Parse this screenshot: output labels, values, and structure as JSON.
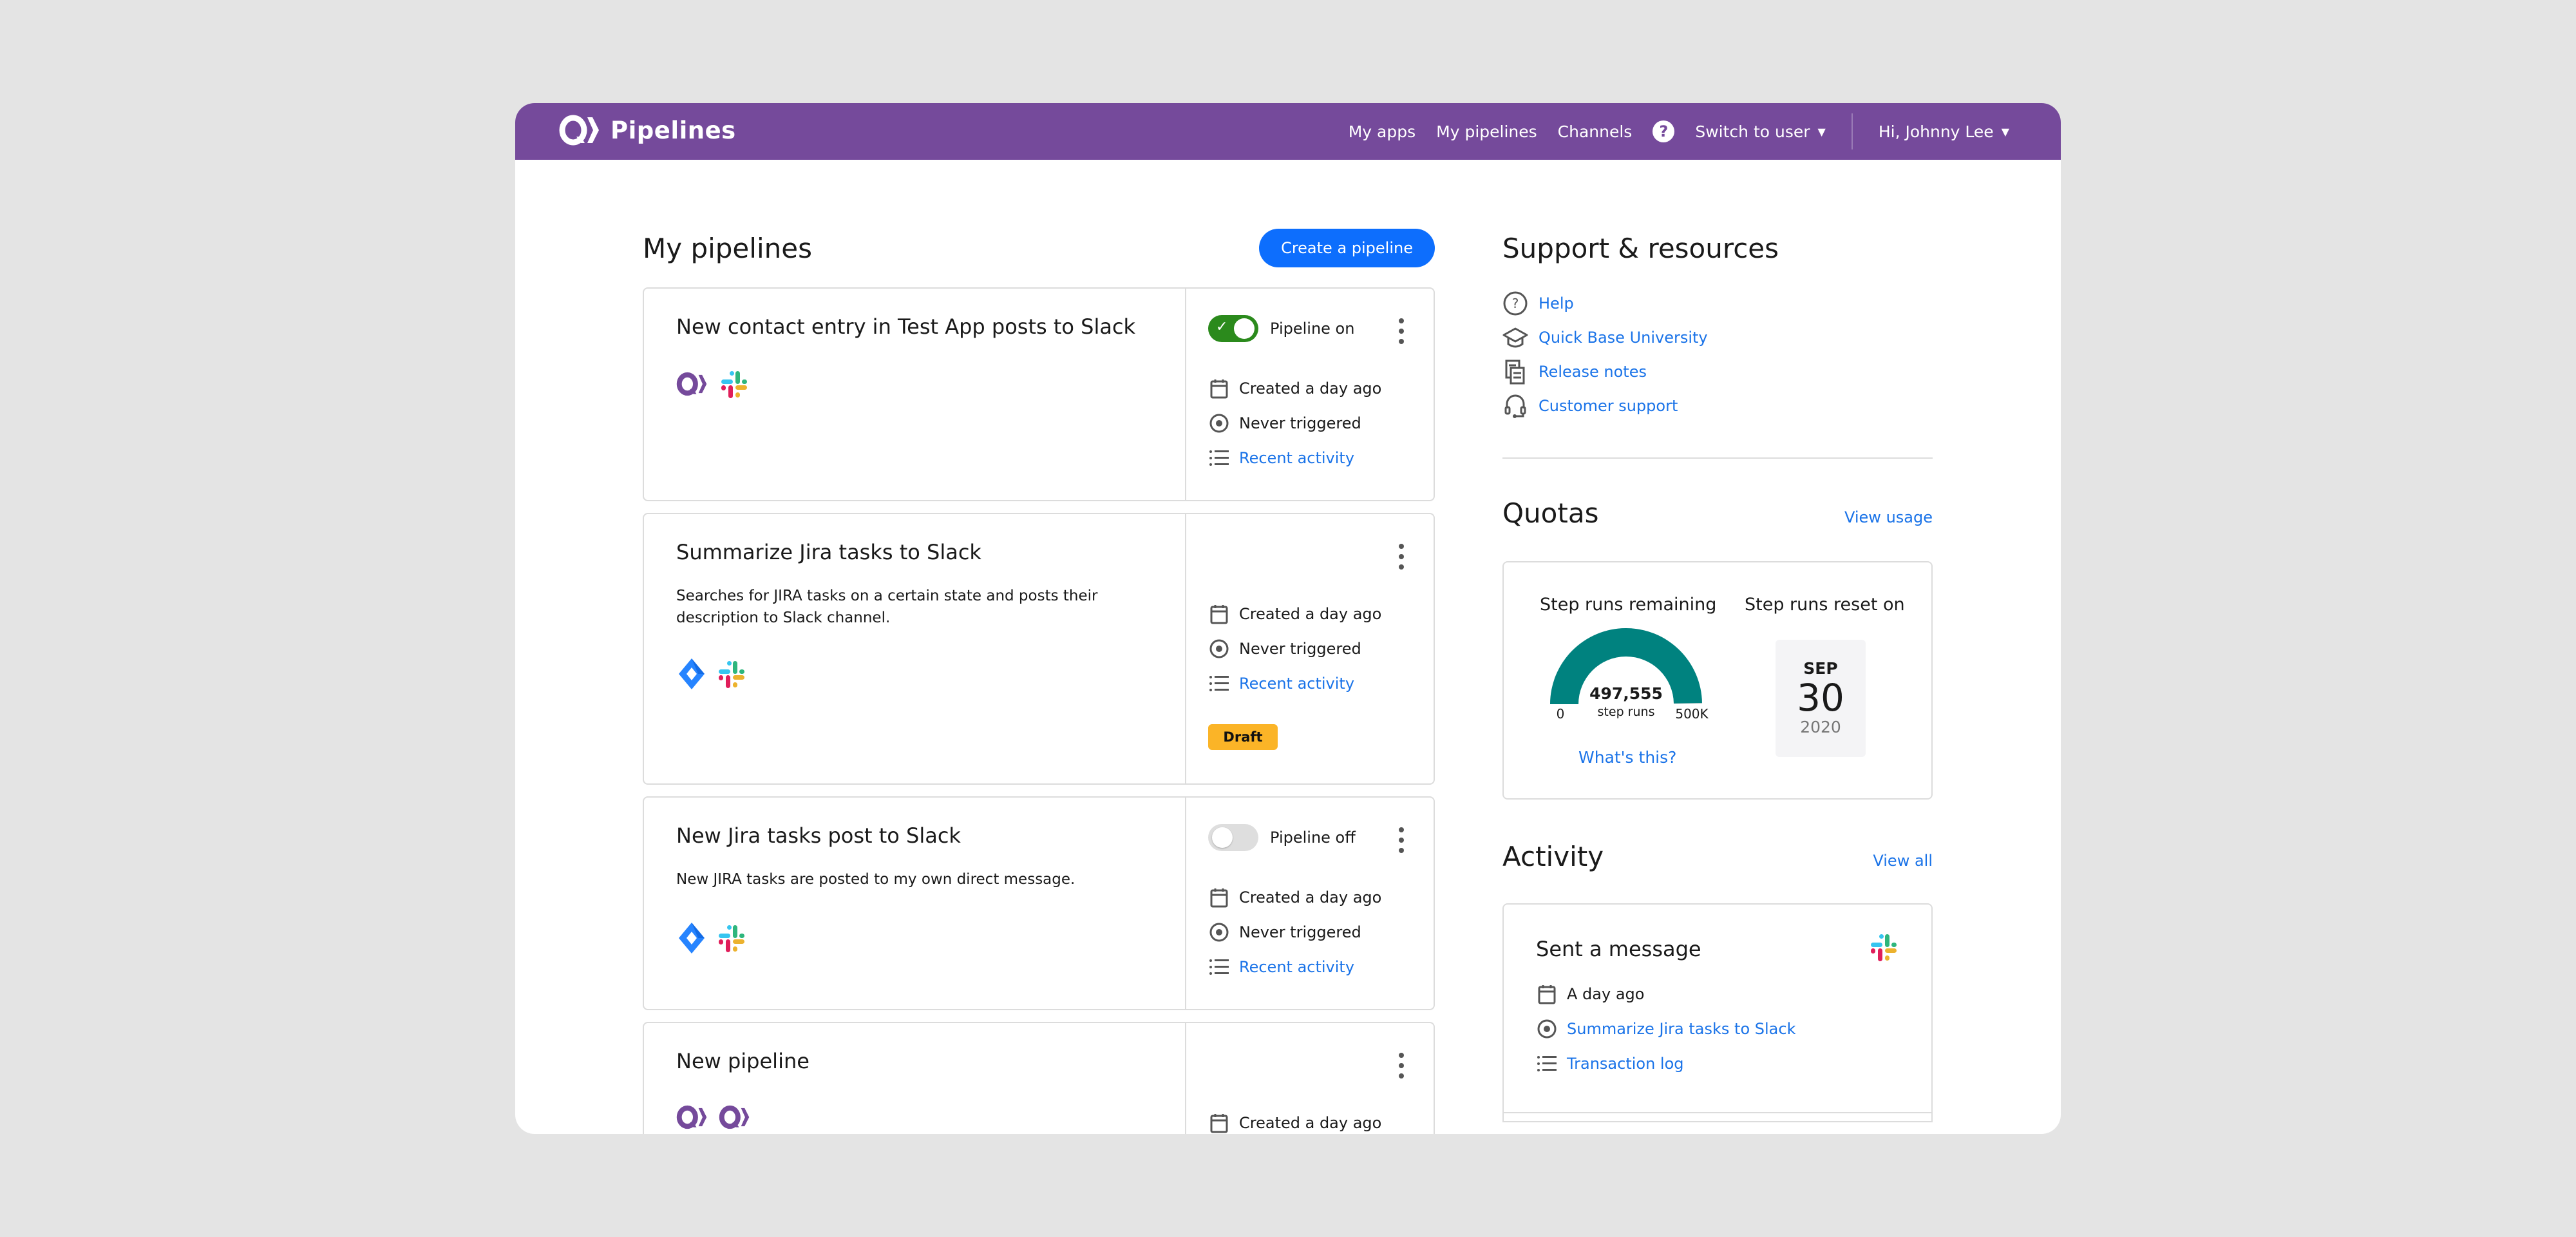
{
  "app": {
    "brand_name": "Pipelines",
    "colors": {
      "brand": "#754a9b",
      "accent": "#0d6efd",
      "link": "#1a73e8",
      "toggle_on": "#2b8a1c",
      "draft": "#fbb427",
      "gauge": "#00827f"
    }
  },
  "nav": {
    "items": [
      {
        "label": "My apps"
      },
      {
        "label": "My pipelines"
      },
      {
        "label": "Channels"
      }
    ],
    "help_label": "?",
    "switch_user_label": "Switch to user",
    "user_greeting": "Hi, Johnny Lee"
  },
  "pipelines": {
    "title": "My pipelines",
    "create_label": "Create a pipeline",
    "cards": [
      {
        "title": "New contact entry in Test App posts to Slack",
        "description": "",
        "icons": [
          "quickbase-icon",
          "slack-icon"
        ],
        "toggle": {
          "state": "on",
          "label": "Pipeline on"
        },
        "created": "Created a day ago",
        "triggered": "Never triggered",
        "activity_link": "Recent activity"
      },
      {
        "title": "Summarize Jira tasks to Slack",
        "description": "Searches for JIRA tasks on a certain state and posts their description to Slack channel.",
        "icons": [
          "jira-icon",
          "slack-icon"
        ],
        "toggle": null,
        "created": "Created a day ago",
        "triggered": "Never triggered",
        "activity_link": "Recent activity",
        "badge": "Draft"
      },
      {
        "title": "New Jira tasks post to Slack",
        "description": "New JIRA tasks are posted to my own direct message.",
        "icons": [
          "jira-icon",
          "slack-icon"
        ],
        "toggle": {
          "state": "off",
          "label": "Pipeline off"
        },
        "created": "Created a day ago",
        "triggered": "Never triggered",
        "activity_link": "Recent activity"
      },
      {
        "title": "New pipeline",
        "description": "",
        "icons": [
          "quickbase-icon",
          "quickbase-icon"
        ],
        "toggle": null,
        "created": "Created a day ago"
      }
    ]
  },
  "support": {
    "title": "Support & resources",
    "links": [
      {
        "icon": "help-circle-icon",
        "label": "Help"
      },
      {
        "icon": "graduation-cap-icon",
        "label": "Quick Base University"
      },
      {
        "icon": "release-notes-icon",
        "label": "Release notes"
      },
      {
        "icon": "headset-icon",
        "label": "Customer support"
      }
    ]
  },
  "quotas": {
    "title": "Quotas",
    "view_usage_label": "View usage",
    "remaining_label": "Step runs remaining",
    "remaining_value": "497,555",
    "remaining_unit": "step runs",
    "remaining_fraction": 0.9951,
    "gauge_min": "0",
    "gauge_max": "500K",
    "whats_this_label": "What's this?",
    "reset_label": "Step runs reset on",
    "reset_month": "SEP",
    "reset_day": "30",
    "reset_year": "2020"
  },
  "activity": {
    "title": "Activity",
    "view_all_label": "View all",
    "items": [
      {
        "title": "Sent a message",
        "icon": "slack-icon",
        "time": "A day ago",
        "pipeline_link": "Summarize Jira tasks to Slack",
        "log_link": "Transaction log"
      }
    ]
  }
}
